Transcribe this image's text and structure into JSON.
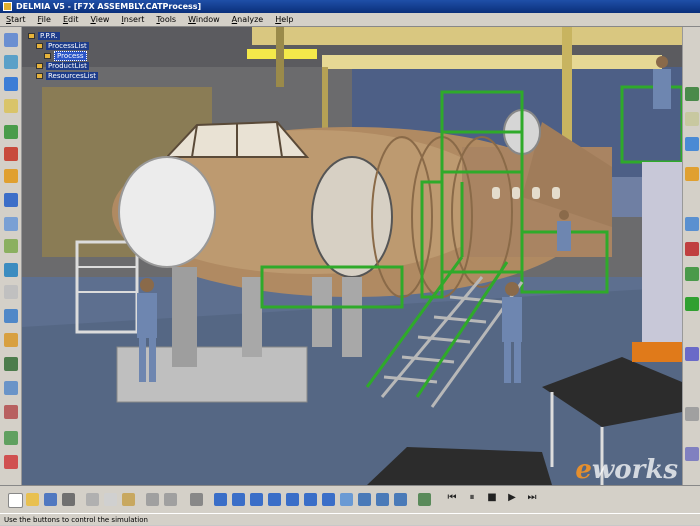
{
  "window": {
    "title": "DELMIA V5 - [F7X ASSEMBLY.CATProcess]"
  },
  "menu": {
    "items": [
      "Start",
      "File",
      "Edit",
      "View",
      "Insert",
      "Tools",
      "Window",
      "Analyze",
      "Help"
    ]
  },
  "tree": {
    "root": "P.P.R.",
    "process_list": "ProcessList",
    "process": "Process",
    "product_list": "ProductList",
    "resources_list": "ResourcesList"
  },
  "playback": {
    "controls": [
      "⏮",
      "⏸",
      "■",
      "▶",
      "⏭"
    ]
  },
  "watermark": {
    "e": "e",
    "rest": "works"
  },
  "status": {
    "message": "Use the buttons to control the simulation"
  }
}
